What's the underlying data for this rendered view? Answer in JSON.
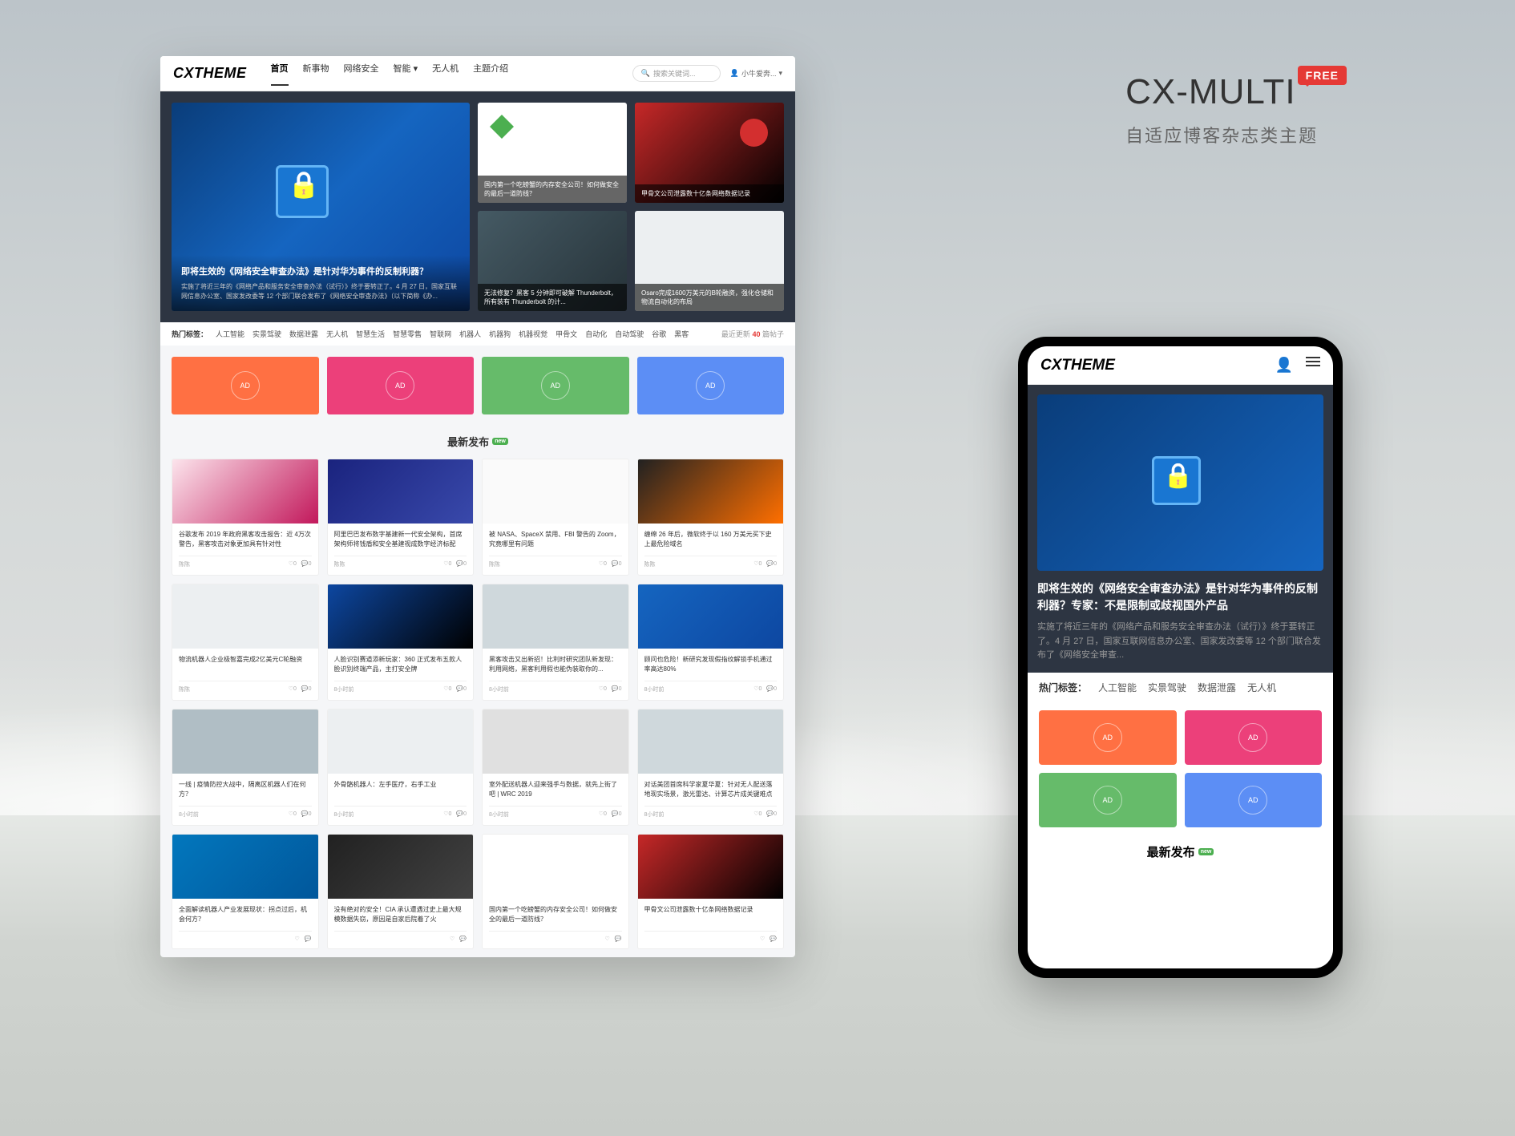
{
  "branding": {
    "title": "CX-MULTI",
    "badge": "FREE",
    "subtitle": "自适应博客杂志类主题"
  },
  "desktop": {
    "logo": "CXTHEME",
    "nav": [
      "首页",
      "新事物",
      "网络安全",
      "智能 ▾",
      "无人机",
      "主题介绍"
    ],
    "search_placeholder": "搜索关键词...",
    "user": "小牛爱奔...",
    "hero_main": {
      "title": "即将生效的《网络安全审查办法》是针对华为事件的反制利器？",
      "desc": "实施了将近三年的《网络产品和服务安全审查办法（试行）》终于要转正了。4 月 27 日，国家互联网信息办公室、国家发改委等 12 个部门联合发布了《网络安全审查办法》（以下简称《办..."
    },
    "hero_sides": [
      {
        "text": "国内第一个吃螃蟹的内存安全公司！如何做安全的最后一道防线？"
      },
      {
        "text": "甲骨文公司泄露数十亿条网络数据记录"
      },
      {
        "text": "无法修复？黑客 5 分钟即可破解 Thunderbolt，所有装有 Thunderbolt 的计..."
      },
      {
        "text": "Osaro完成1600万美元的B轮融资，强化仓储和物流自动化的布局"
      }
    ],
    "tags_label": "热门标签：",
    "tags": [
      "人工智能",
      "实景驾驶",
      "数据泄露",
      "无人机",
      "智慧生活",
      "智慧零售",
      "智联网",
      "机器人",
      "机器狗",
      "机器视觉",
      "甲骨文",
      "自动化",
      "自动驾驶",
      "谷歌",
      "黑客"
    ],
    "update_prefix": "最近更新",
    "update_count": "40",
    "update_suffix": "篇帖子",
    "section_title": "最新发布",
    "section_badge": "new",
    "cards": [
      {
        "t": "谷歌发布 2019 年政府黑客攻击报告：近 4万次警告，黑客攻击对象更加具有针对性",
        "a": "陈陈",
        "l": "0",
        "c": "0"
      },
      {
        "t": "阿里巴巴发布数字基建新一代安全架构，首席架构师将钱盾和安全基建视成数字经济标配",
        "a": "陈陈",
        "l": "0",
        "c": "0"
      },
      {
        "t": "被 NASA、SpaceX 禁用、FBI 警告的 Zoom，究竟哪里有问题",
        "a": "陈陈",
        "l": "0",
        "c": "0"
      },
      {
        "t": "缠绵 26 年后，微软终于以 160 万美元买下史上最危险域名",
        "a": "陈陈",
        "l": "0",
        "c": "0"
      },
      {
        "t": "物流机器人企业极智嘉完成2亿美元C轮融资",
        "a": "陈陈",
        "l": "0",
        "c": "0"
      },
      {
        "t": "人脸识别赛道添新玩家：360 正式发布五款人脸识别终端产品，主打安全牌",
        "a": "8小时前",
        "l": "0",
        "c": "0"
      },
      {
        "t": "黑客攻击又出新招！比利时研究团队新发现：利用网络，黑客利用假也能伪装取你的...",
        "a": "8小时前",
        "l": "0",
        "c": "0"
      },
      {
        "t": "顾问也危险！新研究发现假指纹解锁手机通过率高达80%",
        "a": "8小时前",
        "l": "0",
        "c": "0"
      },
      {
        "t": "一线 | 疫情防控大战中，隔离区机器人们在何方？",
        "a": "8小时前",
        "l": "0",
        "c": "0"
      },
      {
        "t": "外骨骼机器人：左手医疗，右手工业",
        "a": "8小时前",
        "l": "0",
        "c": "0"
      },
      {
        "t": "室外配送机器人迎来强手与数据，就先上街了吧 | WRC 2019",
        "a": "8小时前",
        "l": "0",
        "c": "0"
      },
      {
        "t": "对话美团首席科学家夏华夏：针对无人配送落地现实场景，激光雷达、计算芯片成关键难点",
        "a": "8小时前",
        "l": "0",
        "c": "0"
      },
      {
        "t": "全面解读机器人产业发展现状：拐点过后，机会何方？",
        "a": "",
        "l": "",
        "c": ""
      },
      {
        "t": "没有绝对的安全！CIA 承认遭遇过史上最大规模数据失窃，原因是自家后院着了火",
        "a": "",
        "l": "",
        "c": ""
      },
      {
        "t": "国内第一个吃螃蟹的内存安全公司！如何做安全的最后一道防线？",
        "a": "",
        "l": "",
        "c": ""
      },
      {
        "t": "甲骨文公司泄露数十亿条网络数据记录",
        "a": "",
        "l": "",
        "c": ""
      }
    ]
  },
  "mobile": {
    "logo": "CXTHEME",
    "hero_title": "即将生效的《网络安全审查办法》是针对华为事件的反制利器？专家：不是限制或歧视国外产品",
    "hero_desc": "实施了将近三年的《网络产品和服务安全审查办法（试行）》终于要转正了。4 月 27 日，国家互联网信息办公室、国家发改委等 12 个部门联合发布了《网络安全审查...",
    "tags_label": "热门标签：",
    "tags": [
      "人工智能",
      "实景驾驶",
      "数据泄露",
      "无人机"
    ],
    "section_title": "最新发布",
    "section_badge": "new"
  },
  "ad_label": "AD"
}
